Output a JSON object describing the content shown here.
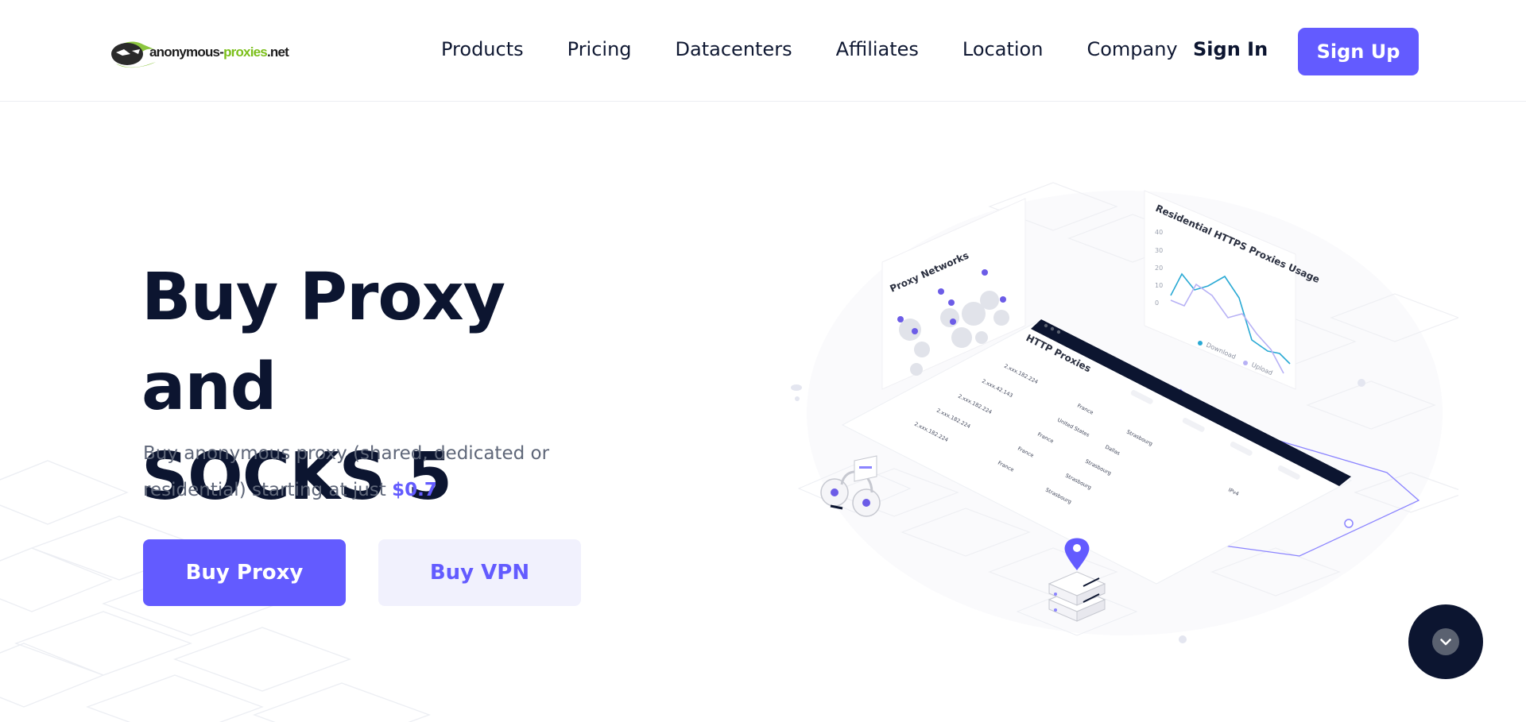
{
  "header": {
    "logo": {
      "text_main": "anonymous-",
      "text_accent": "proxies",
      "text_tld": ".net",
      "icon": "hacker-mask-logo-icon"
    },
    "nav": [
      "Products",
      "Pricing",
      "Datacenters",
      "Affiliates",
      "Location",
      "Company"
    ],
    "sign_in": "Sign In",
    "sign_up": "Sign Up"
  },
  "hero": {
    "title_line1": "Buy Proxy and",
    "title_line2": "SOCKS 5",
    "subtitle_text": "Buy anonymous proxy (shared, dedicated or residential) starting at just",
    "price": "$0.7",
    "buy_proxy": "Buy Proxy",
    "buy_vpn": "Buy VPN"
  },
  "illustration": {
    "map_card_title": "Proxy Networks",
    "chart_card_title": "Residential HTTPS Proxies Usage",
    "chart_ticks": [
      "40",
      "30",
      "20",
      "10",
      "0"
    ],
    "chart_legend": [
      "Download",
      "Upload"
    ],
    "table_title": "HTTP Proxies",
    "table_rows": [
      {
        "ip": "2.xxx.182.224",
        "country": "France",
        "city": "Strasbourg"
      },
      {
        "ip": "2.xxx.42.143",
        "country": "United States",
        "city": "Dallas"
      },
      {
        "ip": "2.xxx.182.224",
        "country": "France",
        "city": "Strasbourg"
      },
      {
        "ip": "2.xxx.182.224",
        "country": "France",
        "city": "Strasbourg"
      },
      {
        "ip": "2.xxx.182.224",
        "country": "France",
        "city": "Strasbourg"
      }
    ],
    "table_extra": "IPv4"
  },
  "colors": {
    "accent": "#635bff",
    "navy": "#0c1530",
    "vpn_bg": "#f1f1fd",
    "chart_download": "#29a9d4",
    "chart_upload": "#b7b1f5"
  },
  "scroll_button": {
    "icon": "chevron-down-icon"
  }
}
